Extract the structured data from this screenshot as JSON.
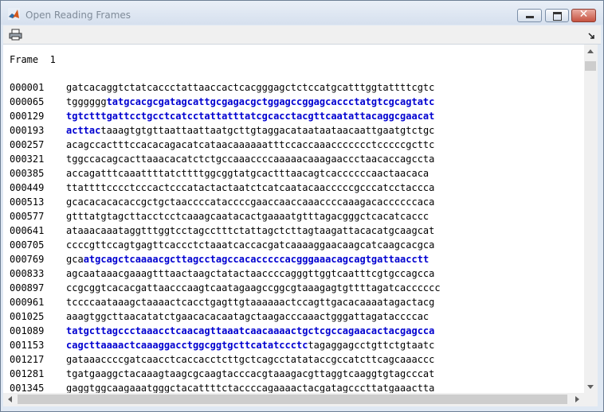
{
  "window": {
    "title": "Open Reading Frames",
    "close_glyph": "✕"
  },
  "icons": {
    "app": "matlab-logo-icon",
    "print": "printer-icon",
    "dock": "dock-arrow-icon"
  },
  "colors": {
    "orf_highlight": "#0000d0"
  },
  "frame_label": "Frame  1",
  "rows": [
    {
      "index": "000001",
      "segments": [
        {
          "text": "gatcacaggtctatcaccctattaaccactcacgggagctctccatgcatttggtattttcgtc",
          "orf": false
        }
      ]
    },
    {
      "index": "000065",
      "segments": [
        {
          "text": "tgggggg",
          "orf": false
        },
        {
          "text": "tatgcacgcgatagcattgcgagacgctggagccggagcaccctatgtcgcagtatc",
          "orf": true
        }
      ]
    },
    {
      "index": "000129",
      "segments": [
        {
          "text": "tgtctttgattcctgcctcatcctattatttatcgcacctacgttcaatattacaggcgaacat",
          "orf": true
        }
      ]
    },
    {
      "index": "000193",
      "segments": [
        {
          "text": "acttac",
          "orf": true
        },
        {
          "text": "taaagtgtgttaattaattaatgcttgtaggacataataataacaattgaatgtctgc",
          "orf": false
        }
      ]
    },
    {
      "index": "000257",
      "segments": [
        {
          "text": "acagccactttccacacagacatcataacaaaaaatttccaccaaaccccccctcccccgcttc",
          "orf": false
        }
      ]
    },
    {
      "index": "000321",
      "segments": [
        {
          "text": "tggccacagcacttaaacacatctctgccaaaccccaaaaacaaagaaccctaacaccagccta",
          "orf": false
        }
      ]
    },
    {
      "index": "000385",
      "segments": [
        {
          "text": "accagatttcaaattttatcttttggcggtatgcactttaacagtcaccccccaactaacaca",
          "orf": false
        }
      ]
    },
    {
      "index": "000449",
      "segments": [
        {
          "text": "ttattttcccctcccactcccatactactaatctcatcaatacaacccccgcccatcctaccca",
          "orf": false
        }
      ]
    },
    {
      "index": "000513",
      "segments": [
        {
          "text": "gcacacacacaccgctgctaaccccataccccgaaccaaccaaaccccaaagacaccccccaca",
          "orf": false
        }
      ]
    },
    {
      "index": "000577",
      "segments": [
        {
          "text": "gtttatgtagcttacctcctcaaagcaatacactgaaaatgtttagacgggctcacatcaccc",
          "orf": false
        }
      ]
    },
    {
      "index": "000641",
      "segments": [
        {
          "text": "ataaacaaataggtttggtcctagcctttctattagctcttagtaagattacacatgcaagcat",
          "orf": false
        }
      ]
    },
    {
      "index": "000705",
      "segments": [
        {
          "text": "ccccgttccagtgagttcaccctctaaatcaccacgatcaaaaggaacaagcatcaagcacgca",
          "orf": false
        }
      ]
    },
    {
      "index": "000769",
      "segments": [
        {
          "text": "gca",
          "orf": false
        },
        {
          "text": "atgcagctcaaaacgcttagcctagccacacccccacgggaaacagcagtgattaacctt",
          "orf": true
        }
      ]
    },
    {
      "index": "000833",
      "segments": [
        {
          "text": "agcaataaacgaaagtttaactaagctatactaaccccagggttggtcaatttcgtgccagcca",
          "orf": false
        }
      ]
    },
    {
      "index": "000897",
      "segments": [
        {
          "text": "ccgcggtcacacgattaacccaagtcaatagaagccggcgtaaagagtgttttagatcacccccc",
          "orf": false
        }
      ]
    },
    {
      "index": "000961",
      "segments": [
        {
          "text": "tccccaataaagctaaaactcacctgagttgtaaaaaactccagttgacacaaaatagactacg",
          "orf": false
        }
      ]
    },
    {
      "index": "001025",
      "segments": [
        {
          "text": "aaagtggcttaacatatctgaacacacaatagctaagacccaaactgggattagataccccac",
          "orf": false
        }
      ]
    },
    {
      "index": "001089",
      "segments": [
        {
          "text": "tatgcttagccctaaacctcaacagttaaatcaacaaaactgctcgccagaacactacgagcca",
          "orf": true
        }
      ]
    },
    {
      "index": "001153",
      "segments": [
        {
          "text": "cagcttaaaactcaaaggacctggcggtgcttcatatccctc",
          "orf": true
        },
        {
          "text": "tagaggagcctgttctgtaatc",
          "orf": false
        }
      ]
    },
    {
      "index": "001217",
      "segments": [
        {
          "text": "gataaaccccgatcaacctcaccacctcttgctcagcctatataccgccatcttcagcaaaccc",
          "orf": false
        }
      ]
    },
    {
      "index": "001281",
      "segments": [
        {
          "text": "tgatgaaggctacaaagtaagcgcaagtacccacgtaaagacgttaggtcaaggtgtagcccat",
          "orf": false
        }
      ]
    },
    {
      "index": "001345",
      "segments": [
        {
          "text": "gaggtggcaagaaatgggctacattttctaccccagaaaactacgatagcccttatgaaactta",
          "orf": false
        }
      ]
    }
  ]
}
